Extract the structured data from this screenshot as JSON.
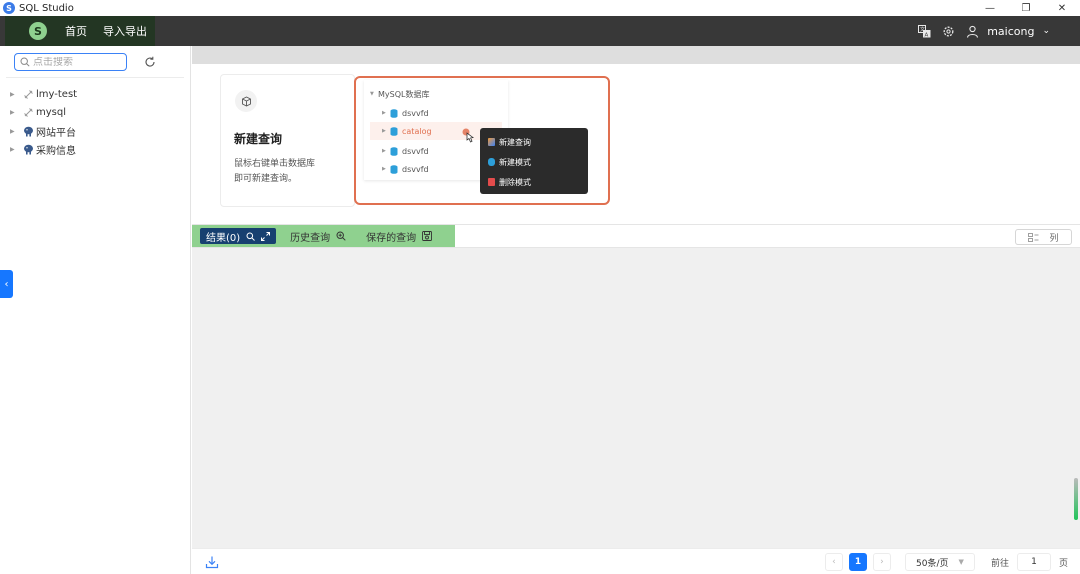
{
  "window": {
    "title": "SQL Studio",
    "logo_glyph": "S",
    "controls": {
      "minimize": "—",
      "restore": "❐",
      "close": "✕"
    }
  },
  "header": {
    "brand_glyph": "S",
    "nav": [
      "首页",
      "导入导出"
    ],
    "username": "maicong",
    "icons": [
      "translate-icon",
      "gear-icon",
      "user-icon",
      "chevron-down-icon"
    ],
    "caret": "⌄"
  },
  "sidebar": {
    "search_placeholder": "点击搜索",
    "items": [
      {
        "label": "lmy-test",
        "icon": "link-icon"
      },
      {
        "label": "mysql",
        "icon": "link-icon"
      },
      {
        "label": "网站平台",
        "icon": "elephant-icon"
      },
      {
        "label": "采购信息",
        "icon": "elephant-icon"
      }
    ],
    "collapse_glyph": "‹"
  },
  "welcome": {
    "card_title": "新建查询",
    "card_desc_line1": "鼠标右键单击数据库",
    "card_desc_line2": "即可新建查询。",
    "tree_root": "MySQL数据库",
    "tree_items": [
      "dsvvfd",
      "catalog",
      "dsvvfd",
      "dsvvfd"
    ],
    "selected_index": 1,
    "context_menu": [
      "新建查询",
      "新建模式",
      "删除模式"
    ]
  },
  "tabs": {
    "items": [
      "结果(0)",
      "历史查询",
      "保存的查询"
    ],
    "active_index": 0,
    "columns_button": "列"
  },
  "pagination": {
    "prev": "‹",
    "current_page": "1",
    "next": "›",
    "page_size": "50条/页",
    "goto_label": "前往",
    "goto_value": "1",
    "page_unit": "页"
  },
  "colors": {
    "header_bg": "#383838",
    "nav_bg": "#233623",
    "accent_blue": "#1677ff",
    "tab_bar_green": "#8fd18f",
    "active_tab": "#174070",
    "preview_border": "#e07050"
  }
}
